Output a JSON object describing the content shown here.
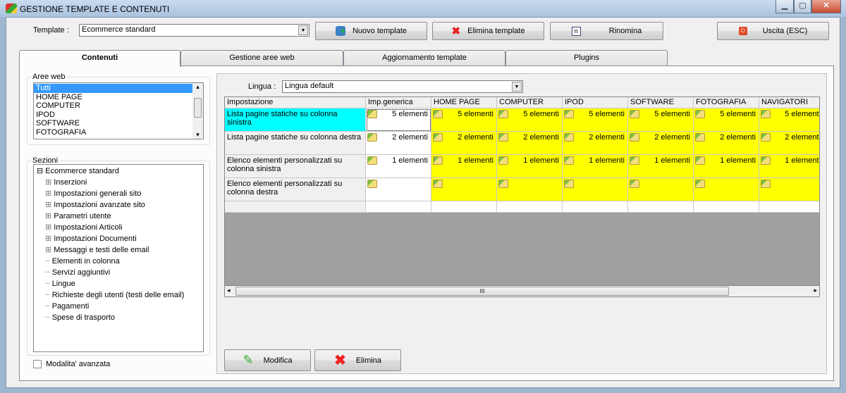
{
  "window": {
    "title": "GESTIONE TEMPLATE E CONTENUTI",
    "minimize": "▁",
    "maximize": "▢",
    "close": "✕"
  },
  "toolbar": {
    "template_label": "Template :",
    "template_value": "Ecommerce standard",
    "new_template": "Nuovo template",
    "delete_template": "Elimina template",
    "rename": "Rinomina",
    "exit": "Uscita (ESC)"
  },
  "tabs": [
    {
      "label": "Contenuti",
      "active": true
    },
    {
      "label": "Gestione aree web"
    },
    {
      "label": "Aggiornamento template"
    },
    {
      "label": "Plugins"
    }
  ],
  "aree_web": {
    "label": "Aree web",
    "items": [
      "Tutti",
      "HOME PAGE",
      "COMPUTER",
      "IPOD",
      "SOFTWARE",
      "FOTOGRAFIA"
    ],
    "selected": "Tutti"
  },
  "sezioni": {
    "label": "Sezioni",
    "root": "Ecommerce standard",
    "items": [
      {
        "label": "Inserzioni",
        "expandable": true
      },
      {
        "label": "Impostazioni generali sito",
        "expandable": true
      },
      {
        "label": "Impostazioni avanzate sito",
        "expandable": true
      },
      {
        "label": "Parametri utente",
        "expandable": true
      },
      {
        "label": "Impostazioni Articoli",
        "expandable": true
      },
      {
        "label": "Impostazioni Documenti",
        "expandable": true
      },
      {
        "label": "Messaggi e testi delle email",
        "expandable": true
      },
      {
        "label": "Elementi in colonna"
      },
      {
        "label": "Servizi aggiuntivi"
      },
      {
        "label": "Lingue"
      },
      {
        "label": "Richieste degli utenti (testi delle email)"
      },
      {
        "label": "Pagamenti"
      },
      {
        "label": "Spese di trasporto"
      }
    ]
  },
  "advanced_mode": {
    "label": "Modalita' avanzata",
    "checked": false
  },
  "lingua": {
    "label": "Lingua :",
    "value": "Lingua default"
  },
  "grid": {
    "columns": [
      "Impostazione",
      "Imp.generica",
      "HOME PAGE",
      "COMPUTER",
      "IPOD",
      "SOFTWARE",
      "FOTOGRAFIA",
      "NAVIGATORI"
    ],
    "rows": [
      {
        "name": "Lista pagine statiche su colonna sinistra",
        "value": "5 elementi"
      },
      {
        "name": "Lista pagine statiche su colonna destra",
        "value": "2 elementi"
      },
      {
        "name": "Elenco elementi personalizzati su colonna sinistra",
        "value": "1 elementi"
      },
      {
        "name": "Elenco elementi personalizzati su colonna destra",
        "value": ""
      }
    ],
    "colors": {
      "selected_row": "#00ffff",
      "area_cell": "#ffff00"
    }
  },
  "actions": {
    "modify": "Modifica",
    "delete": "Elimina"
  },
  "scroll": {
    "grip": "III",
    "left": "◂",
    "right": "▸",
    "up": "▴",
    "down": "▾"
  }
}
